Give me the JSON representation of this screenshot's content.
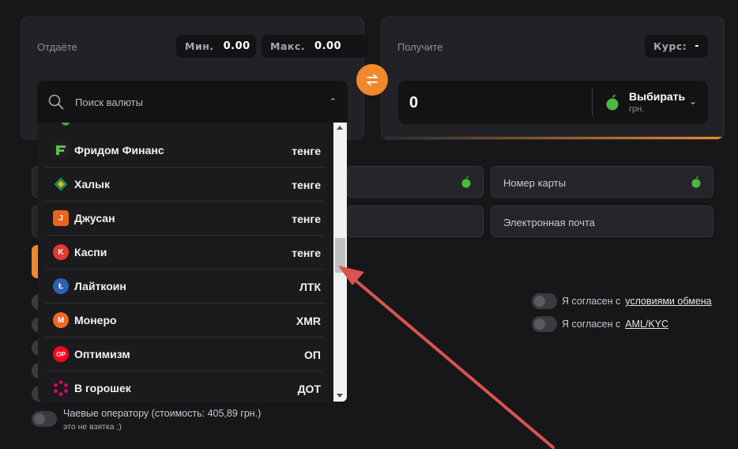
{
  "give": {
    "label": "Отдаёте",
    "min_key": "Мин.",
    "min_value": "0.00",
    "max_key": "Макс.",
    "max_value": "0.00",
    "search_placeholder": "Поиск валюты"
  },
  "get": {
    "label": "Получите",
    "rate_key": "Курс:",
    "rate_value": "-",
    "amount": "0",
    "currency_name": "Выбирать",
    "currency_unit": "грн."
  },
  "fields": {
    "card_number": "Номер карты",
    "email": "Электронная почта"
  },
  "agreements": {
    "terms_prefix": "Я согласен с",
    "terms_link": "условиями обмена",
    "aml_prefix": "Я согласен с",
    "aml_link": "AML/KYC"
  },
  "tip": {
    "label": "Чаевые оператору (стоимость: 405,89 грн.)",
    "sub": "это не взятка ;)"
  },
  "dropdown": {
    "items": [
      {
        "name": "Фридом Финанс",
        "code": "тенге",
        "icon": "freedom-finance-icon",
        "color": "#1f1f22"
      },
      {
        "name": "Халык",
        "code": "тенге",
        "icon": "halyk-icon",
        "color": "#1f1f22"
      },
      {
        "name": "Джусан",
        "code": "тенге",
        "icon": "jusan-icon",
        "color": "#e8641c"
      },
      {
        "name": "Каспи",
        "code": "тенге",
        "icon": "kaspi-icon",
        "color": "#e23b30"
      },
      {
        "name": "Лайткоин",
        "code": "ЛТК",
        "icon": "litecoin-icon",
        "color": "#2f5fb3"
      },
      {
        "name": "Монеро",
        "code": "XMR",
        "icon": "monero-icon",
        "color": "#f26822"
      },
      {
        "name": "Оптимизм",
        "code": "ОП",
        "icon": "optimism-icon",
        "color": "#ff0420"
      },
      {
        "name": "В горошек",
        "code": "ДОТ",
        "icon": "polkadot-icon",
        "color": "#1b1b1e"
      }
    ]
  },
  "colors": {
    "accent": "#f0892c",
    "background": "#17171a",
    "card": "#222226",
    "annotation_arrow": "#d9534f"
  }
}
